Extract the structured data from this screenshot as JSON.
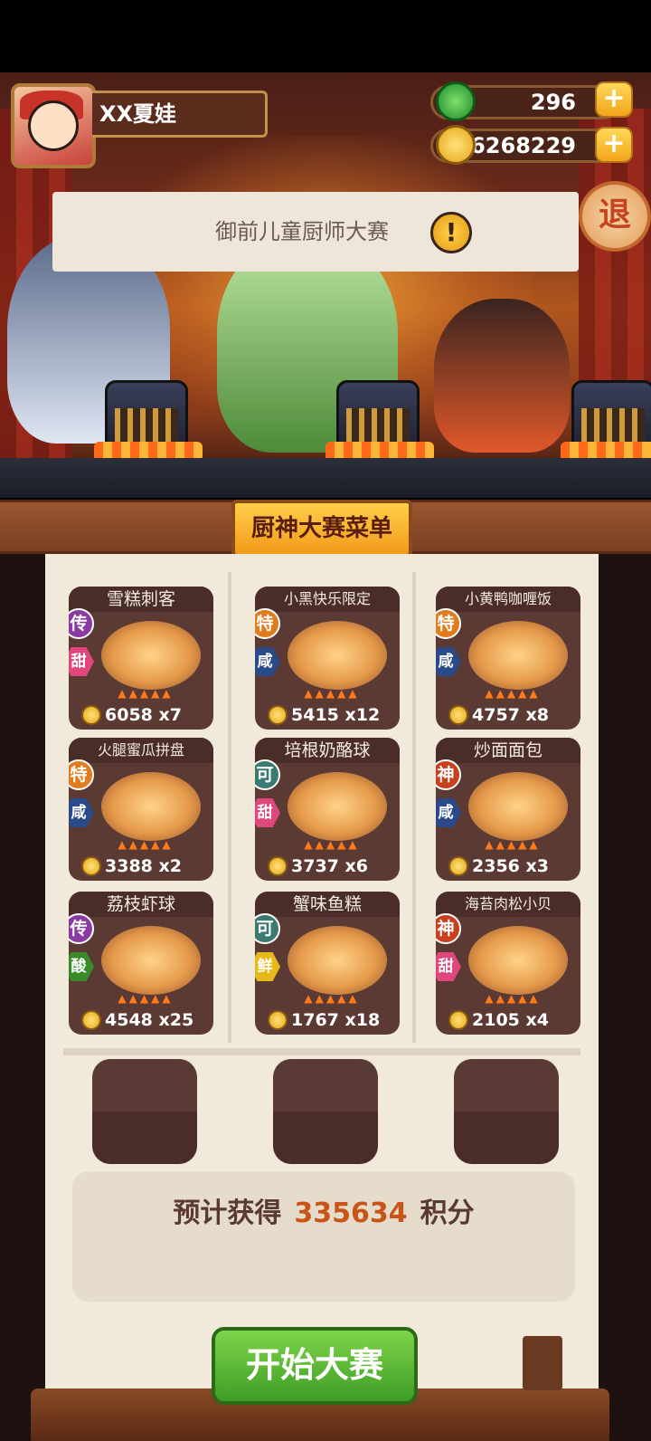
{
  "player": {
    "name": "XX夏娃"
  },
  "resources": {
    "jade": {
      "value": "296",
      "icon": "jade-coin-icon",
      "plus": "+"
    },
    "gold": {
      "value": "16268229",
      "icon": "gold-coin-icon",
      "plus": "+"
    }
  },
  "event": {
    "title": "御前儿童厨师大赛",
    "alert": "!",
    "exit_label": "退"
  },
  "menu": {
    "title": "厨神大赛菜单",
    "dishes": [
      {
        "name": "雪糕刺客",
        "grade": "传",
        "flavor": "甜",
        "price": "6058",
        "qty": "x7"
      },
      {
        "name": "小黑快乐限定",
        "grade": "特",
        "flavor": "咸",
        "price": "5415",
        "qty": "x12"
      },
      {
        "name": "小黄鸭咖喱饭",
        "grade": "特",
        "flavor": "咸",
        "price": "4757",
        "qty": "x8"
      },
      {
        "name": "火腿蜜瓜拼盘",
        "grade": "特",
        "flavor": "咸",
        "price": "3388",
        "qty": "x2"
      },
      {
        "name": "培根奶酪球",
        "grade": "可",
        "flavor": "甜",
        "price": "3737",
        "qty": "x6"
      },
      {
        "name": "炒面面包",
        "grade": "神",
        "flavor": "咸",
        "price": "2356",
        "qty": "x3"
      },
      {
        "name": "荔枝虾球",
        "grade": "传",
        "flavor": "酸",
        "price": "4548",
        "qty": "x25"
      },
      {
        "name": "蟹味鱼糕",
        "grade": "可",
        "flavor": "鲜",
        "price": "1767",
        "qty": "x18"
      },
      {
        "name": "海苔肉松小贝",
        "grade": "神",
        "flavor": "甜",
        "price": "2105",
        "qty": "x4"
      }
    ]
  },
  "score": {
    "prefix": "预计获得",
    "value": "335634",
    "suffix": "积分"
  },
  "start_button": "开始大赛",
  "colors": {
    "accent_green": "#3f9e26",
    "score_orange": "#c85418",
    "board_gold": "#f39a1a"
  }
}
